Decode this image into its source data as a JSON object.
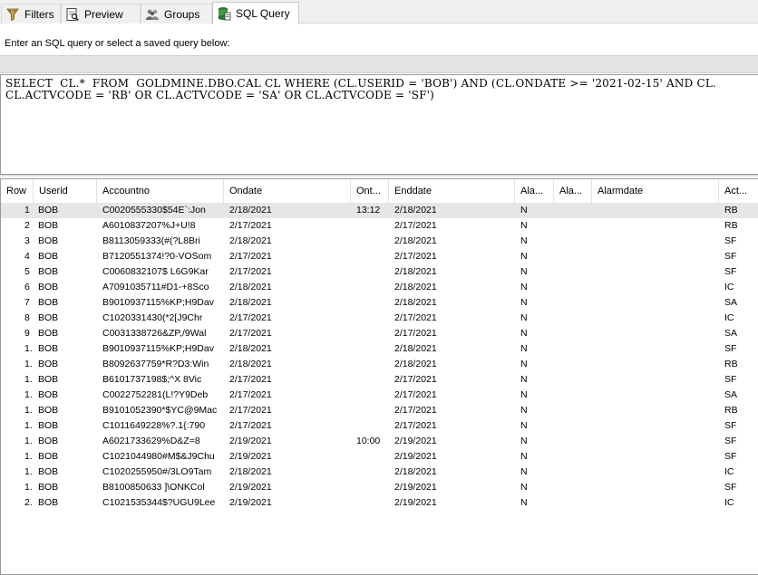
{
  "tabs": [
    {
      "label": "Filters",
      "icon": "filter-icon"
    },
    {
      "label": "Preview",
      "icon": "preview-icon"
    },
    {
      "label": "Groups",
      "icon": "groups-icon"
    },
    {
      "label": "SQL Query",
      "icon": "sql-query-icon",
      "active": true
    }
  ],
  "prompt": "Enter an SQL query or select a saved query below:",
  "sql": {
    "line1": "SELECT  CL.*  FROM  GOLDMINE.DBO.CAL CL WHERE (CL.USERID = 'BOB') AND (CL.ONDATE >= '2021-02-15' AND CL.",
    "line2": "CL.ACTVCODE = 'RB' OR CL.ACTVCODE = 'SA' OR CL.ACTVCODE = 'SF')"
  },
  "grid": {
    "columns": [
      "Row",
      "Userid",
      "Accountno",
      "Ondate",
      "Ont...",
      "Enddate",
      "Ala...",
      "Ala...",
      "Alarmdate",
      "Act..."
    ],
    "rows": [
      [
        "1",
        "BOB",
        "C0020555330$54E`:Jon",
        "2/18/2021",
        "13:12",
        "2/18/2021",
        "N",
        "",
        "",
        "RB"
      ],
      [
        "2",
        "BOB",
        "A6010837207%J+U!8",
        "2/17/2021",
        "",
        "2/17/2021",
        "N",
        "",
        "",
        "RB"
      ],
      [
        "3",
        "BOB",
        "B8113059333(#(?L8Bri",
        "2/18/2021",
        "",
        "2/18/2021",
        "N",
        "",
        "",
        "SF"
      ],
      [
        "4",
        "BOB",
        "B7120551374!?0-VOSom",
        "2/17/2021",
        "",
        "2/17/2021",
        "N",
        "",
        "",
        "SF"
      ],
      [
        "5",
        "BOB",
        "C0060832107$ L6G9Kar",
        "2/17/2021",
        "",
        "2/18/2021",
        "N",
        "",
        "",
        "SF"
      ],
      [
        "6",
        "BOB",
        "A7091035711#D1-+8Sco",
        "2/18/2021",
        "",
        "2/18/2021",
        "N",
        "",
        "",
        "IC"
      ],
      [
        "7",
        "BOB",
        "B9010937115%KP;H9Dav",
        "2/18/2021",
        "",
        "2/18/2021",
        "N",
        "",
        "",
        "SA"
      ],
      [
        "8",
        "BOB",
        "C1020331430(*2[J9Chr",
        "2/17/2021",
        "",
        "2/17/2021",
        "N",
        "",
        "",
        "IC"
      ],
      [
        "9",
        "BOB",
        "C0031338726&ZP,/9Wal",
        "2/17/2021",
        "",
        "2/17/2021",
        "N",
        "",
        "",
        "SA"
      ],
      [
        "1.",
        "BOB",
        "B9010937115%KP;H9Dav",
        "2/18/2021",
        "",
        "2/18/2021",
        "N",
        "",
        "",
        "SF"
      ],
      [
        "1.",
        "BOB",
        "B8092637759*R?D3:Win",
        "2/18/2021",
        "",
        "2/18/2021",
        "N",
        "",
        "",
        "RB"
      ],
      [
        "1.",
        "BOB",
        "B6101737198$;^X 8Vic",
        "2/17/2021",
        "",
        "2/17/2021",
        "N",
        "",
        "",
        "SF"
      ],
      [
        "1.",
        "BOB",
        "C0022752281(L!?Y9Deb",
        "2/17/2021",
        "",
        "2/17/2021",
        "N",
        "",
        "",
        "SA"
      ],
      [
        "1.",
        "BOB",
        "B9101052390*$YC@9Mac",
        "2/17/2021",
        "",
        "2/17/2021",
        "N",
        "",
        "",
        "RB"
      ],
      [
        "1.",
        "BOB",
        "C1011649228%?.1{:790",
        "2/17/2021",
        "",
        "2/17/2021",
        "N",
        "",
        "",
        "SF"
      ],
      [
        "1.",
        "BOB",
        "A6021733629%D&Z=8",
        "2/19/2021",
        "10:00",
        "2/19/2021",
        "N",
        "",
        "",
        "SF"
      ],
      [
        "1.",
        "BOB",
        "C1021044980#M$&J9Chu",
        "2/19/2021",
        "",
        "2/19/2021",
        "N",
        "",
        "",
        "SF"
      ],
      [
        "1.",
        "BOB",
        "C1020255950#/3LO9Tam",
        "2/18/2021",
        "",
        "2/18/2021",
        "N",
        "",
        "",
        "IC"
      ],
      [
        "1.",
        "BOB",
        "B8100850633 ]\\ONKCol",
        "2/19/2021",
        "",
        "2/19/2021",
        "N",
        "",
        "",
        "SF"
      ],
      [
        "2.",
        "BOB",
        "C1021535344$?UGU9Lee",
        "2/19/2021",
        "",
        "2/19/2021",
        "N",
        "",
        "",
        "IC"
      ]
    ]
  }
}
